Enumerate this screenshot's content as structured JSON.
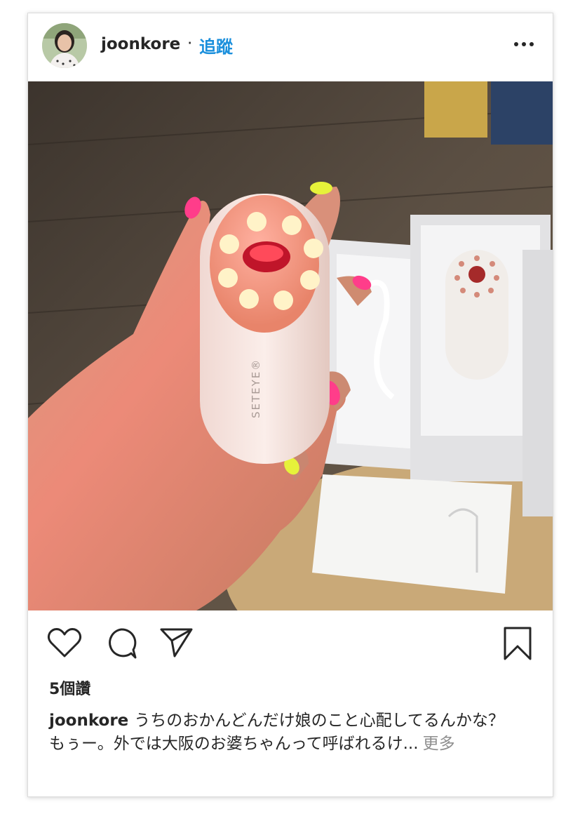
{
  "post": {
    "username": "joonkore",
    "separator": "·",
    "follow_label": "追蹤",
    "more_options_icon": "more-horizontal-icon",
    "photo_label": "SETEYE®"
  },
  "actions": {
    "like_icon": "heart-icon",
    "comment_icon": "comment-icon",
    "share_icon": "paper-plane-icon",
    "save_icon": "bookmark-icon"
  },
  "likes": {
    "text": "5個讚"
  },
  "caption": {
    "username": "joonkore",
    "line1": "うちのおかんどんだけ娘のこと心配してるんかな？",
    "line2": "もぅー。外では大阪のお婆ちゃんって呼ばれるけ...",
    "more_label": "更多"
  },
  "colors": {
    "follow_blue": "#1a8fdc",
    "text": "#262626",
    "muted": "#8e8e8e"
  }
}
